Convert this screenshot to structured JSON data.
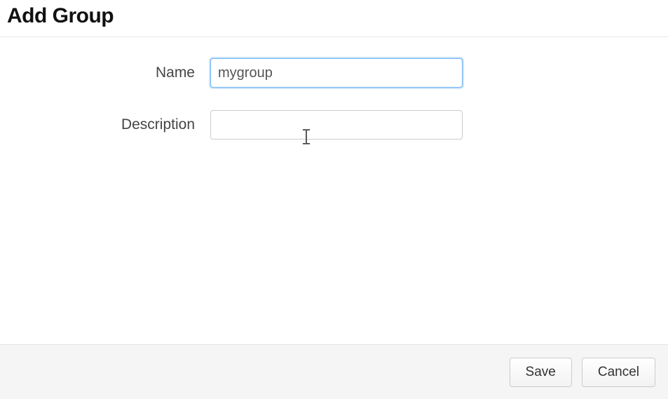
{
  "header": {
    "title": "Add Group"
  },
  "form": {
    "name": {
      "label": "Name",
      "value": "mygroup"
    },
    "description": {
      "label": "Description",
      "value": ""
    }
  },
  "footer": {
    "save_label": "Save",
    "cancel_label": "Cancel"
  }
}
